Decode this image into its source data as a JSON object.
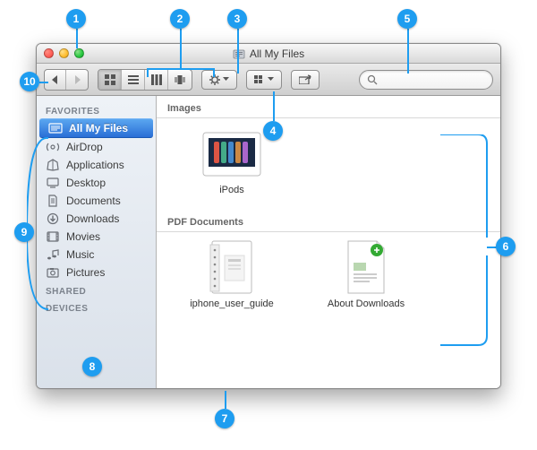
{
  "callouts": [
    "1",
    "2",
    "3",
    "4",
    "5",
    "6",
    "7",
    "8",
    "9",
    "10"
  ],
  "window": {
    "title": "All My Files"
  },
  "toolbar": {
    "search_placeholder": ""
  },
  "sidebar": {
    "sections": {
      "favorites": "FAVORITES",
      "shared": "SHARED",
      "devices": "DEVICES"
    },
    "items": [
      {
        "label": "All My Files"
      },
      {
        "label": "AirDrop"
      },
      {
        "label": "Applications"
      },
      {
        "label": "Desktop"
      },
      {
        "label": "Documents"
      },
      {
        "label": "Downloads"
      },
      {
        "label": "Movies"
      },
      {
        "label": "Music"
      },
      {
        "label": "Pictures"
      }
    ]
  },
  "content": {
    "groups": [
      {
        "heading": "Images",
        "files": [
          {
            "name": "iPods"
          }
        ]
      },
      {
        "heading": "PDF Documents",
        "files": [
          {
            "name": "iphone_user_guide"
          },
          {
            "name": "About Downloads"
          }
        ]
      }
    ]
  }
}
